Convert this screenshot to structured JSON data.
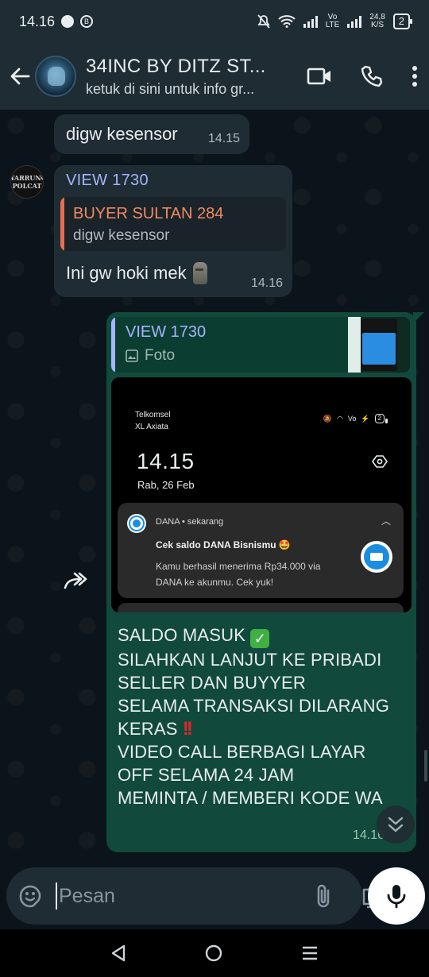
{
  "status_bar": {
    "time": "14.16",
    "net_speed_top": "24,8",
    "net_speed_bottom": "K/S",
    "volte": "Vo",
    "lte": "LTE",
    "battery": "2"
  },
  "header": {
    "title": "34INC BY DITZ ST...",
    "subtitle": "ketuk di sini untuk info gr..."
  },
  "messages": [
    {
      "text": "digw kesensor",
      "time": "14.15"
    },
    {
      "sender": "VIEW 1730",
      "sender_color": "#a5b5ff",
      "avatar_text_top": "WARRUNG",
      "avatar_text_bottom": "POLCAT",
      "quote_name": "BUYER SULTAN 284",
      "quote_color": "#f08a63",
      "quote_text": "digw kesensor",
      "text": "Ini gw hoki mek",
      "time": "14.16"
    }
  ],
  "outgoing": {
    "quote_name": "VIEW 1730",
    "quote_kind": "Foto",
    "screenshot": {
      "carrier1": "Telkomsel",
      "carrier2": "XL Axiata",
      "time": "14.15",
      "date": "Rab, 26 Feb",
      "notif_app": "DANA • sekarang",
      "notif_title": "Cek saldo DANA Bisnismu 🤩",
      "notif_body": "Kamu berhasil menerima Rp34.000 via DANA ke akunmu. Cek yuk!"
    },
    "caption_lines": [
      "SALDO MASUK",
      "SILAHKAN LANJUT KE PRIBADI",
      "SELLER DAN BUYYER",
      "SELAMA TRANSAKSI DILARANG",
      "KERAS",
      "VIDEO CALL BERBAGI LAYAR",
      "OFF SELAMA 24 JAM",
      "MEMINTA / MEMBERI KODE WA"
    ],
    "time": "14.16"
  },
  "input": {
    "placeholder": "Pesan"
  },
  "colors": {
    "header_bg": "#1f2c34",
    "incoming_bubble": "#202c33",
    "outgoing_bubble": "#114a3c",
    "chat_bg": "#0b141a"
  },
  "icons": [
    "back-arrow-icon",
    "video-call-icon",
    "phone-icon",
    "more-vert-icon",
    "forward-icon",
    "image-icon",
    "sticker-icon",
    "attach-icon",
    "camera-icon",
    "mic-icon",
    "chevron-double-down-icon",
    "nav-back-icon",
    "nav-home-icon",
    "nav-recents-icon"
  ]
}
